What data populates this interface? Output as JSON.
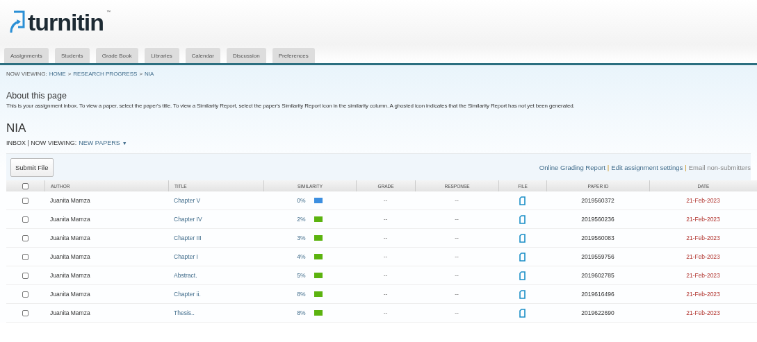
{
  "logo": {
    "text": "turnitin",
    "mark": "™"
  },
  "tabs": [
    {
      "label": "Assignments",
      "selected": false
    },
    {
      "label": "Students",
      "selected": false
    },
    {
      "label": "Grade Book",
      "selected": false
    },
    {
      "label": "Libraries",
      "selected": false
    },
    {
      "label": "Calendar",
      "selected": false
    },
    {
      "label": "Discussion",
      "selected": false
    },
    {
      "label": "Preferences",
      "selected": false
    }
  ],
  "breadcrumb": {
    "label": "NOW VIEWING:",
    "links": [
      "HOME",
      "RESEARCH PROGRESS",
      "NIA"
    ],
    "separator": ">"
  },
  "about": {
    "title": "About this page",
    "text": "This is your assignment inbox. To view a paper, select the paper's title. To view a Similarity Report, select the paper's Similarity Report icon in the similarity column. A ghosted icon indicates that the Similarity Report has not yet been generated."
  },
  "assignment": {
    "title": "NIA",
    "inbox": "INBOX | NOW VIEWING:",
    "view": "NEW PAPERS",
    "caret": "▼"
  },
  "toolbar": {
    "button": "Submit File",
    "separators": [
      "|",
      "|"
    ],
    "links": [
      {
        "label": "Online Grading Report",
        "disabled": false
      },
      {
        "label": "Edit assignment settings",
        "disabled": false
      },
      {
        "label": "Email non-submitters",
        "disabled": true
      }
    ]
  },
  "table": {
    "all_checked": false,
    "columns": [
      "AUTHOR",
      "TITLE",
      "SIMILARITY",
      "GRADE",
      "RESPONSE",
      "FILE",
      "PAPER ID",
      "DATE"
    ],
    "rows": [
      {
        "checked": false,
        "author": "Juanita Mamza",
        "title": "Chapter V",
        "similarity": "0%",
        "color": "#3d8fe0",
        "grade": "--",
        "response": "--",
        "paper_id": "2019560372",
        "date": "21-Feb-2023"
      },
      {
        "checked": false,
        "author": "Juanita Mamza",
        "title": "Chapter IV",
        "similarity": "2%",
        "color": "#5cb30f",
        "grade": "--",
        "response": "--",
        "paper_id": "2019560236",
        "date": "21-Feb-2023"
      },
      {
        "checked": false,
        "author": "Juanita Mamza",
        "title": "Chapter III",
        "similarity": "3%",
        "color": "#5cb30f",
        "grade": "--",
        "response": "--",
        "paper_id": "2019560083",
        "date": "21-Feb-2023"
      },
      {
        "checked": false,
        "author": "Juanita Mamza",
        "title": "Chapter I",
        "similarity": "4%",
        "color": "#5cb30f",
        "grade": "--",
        "response": "--",
        "paper_id": "2019559756",
        "date": "21-Feb-2023"
      },
      {
        "checked": false,
        "author": "Juanita Mamza",
        "title": "Abstract.",
        "similarity": "5%",
        "color": "#5cb30f",
        "grade": "--",
        "response": "--",
        "paper_id": "2019602785",
        "date": "21-Feb-2023"
      },
      {
        "checked": false,
        "author": "Juanita Mamza",
        "title": "Chapter ii.",
        "similarity": "8%",
        "color": "#5cb30f",
        "grade": "--",
        "response": "--",
        "paper_id": "2019616496",
        "date": "21-Feb-2023"
      },
      {
        "checked": false,
        "author": "Juanita Mamza",
        "title": "Thesis..",
        "similarity": "8%",
        "color": "#5cb30f",
        "grade": "--",
        "response": "--",
        "paper_id": "2019622690",
        "date": "21-Feb-2023"
      }
    ]
  }
}
